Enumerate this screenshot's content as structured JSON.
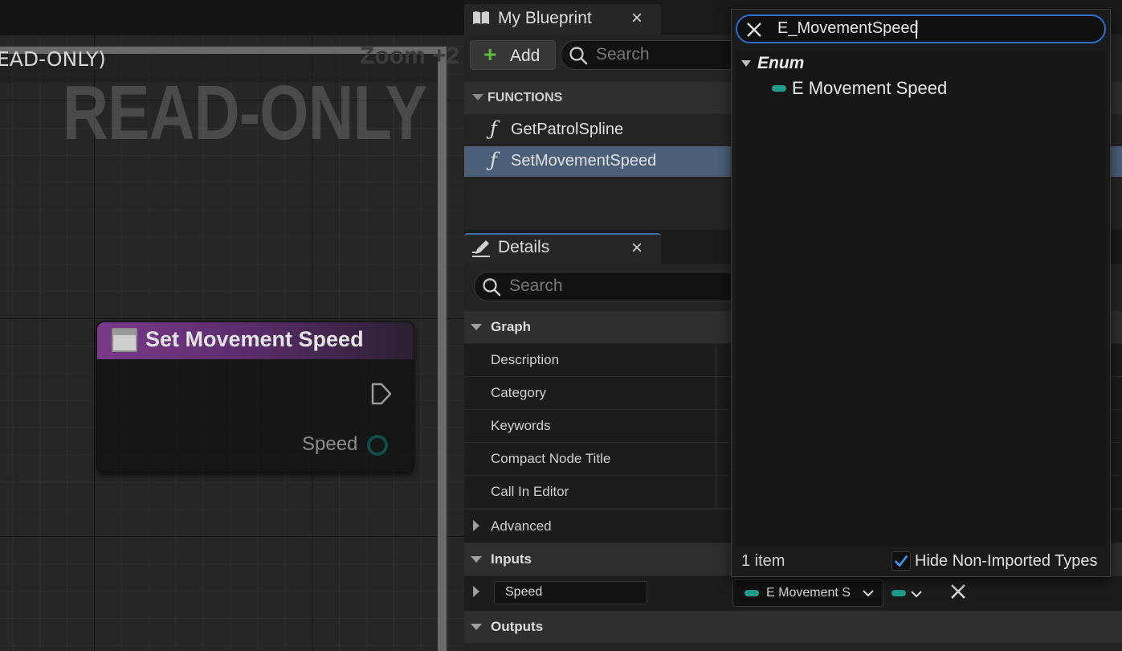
{
  "graph": {
    "title_partial": "EAD-ONLY)",
    "zoom": "Zoom +2",
    "watermark": "READ-ONLY",
    "node": {
      "title": "Set Movement Speed",
      "output_pin_label": "Speed"
    }
  },
  "my_blueprint": {
    "tab_label": "My Blueprint",
    "close_glyph": "×",
    "add_label": "Add",
    "search_placeholder": "Search",
    "functions_header": "FUNCTIONS",
    "functions": [
      {
        "label": "GetPatrolSpline",
        "selected": false
      },
      {
        "label": "SetMovementSpeed",
        "selected": true
      }
    ],
    "function_glyph": "ƒ"
  },
  "details": {
    "tab_label": "Details",
    "close_glyph": "×",
    "search_placeholder": "Search",
    "graph_category": "Graph",
    "graph_props": [
      "Description",
      "Category",
      "Keywords",
      "Compact Node Title",
      "Call In Editor"
    ],
    "advanced_label": "Advanced",
    "inputs_category": "Inputs",
    "input_param": {
      "name": "Speed",
      "type": "E Movement S"
    },
    "outputs_category": "Outputs"
  },
  "type_picker": {
    "query": "E_MovementSpeed",
    "category": "Enum",
    "results": [
      "E Movement Speed"
    ],
    "item_count": "1 item",
    "hide_non_imported_label": "Hide Non-Imported Types",
    "hide_non_imported_checked": true
  },
  "colors": {
    "enum_pill": "#1f9e8f",
    "selection": "#4b5f79",
    "focus_border": "#2f6dd1",
    "node_header": "#7a3a89",
    "add_plus": "#5bbd3a"
  }
}
